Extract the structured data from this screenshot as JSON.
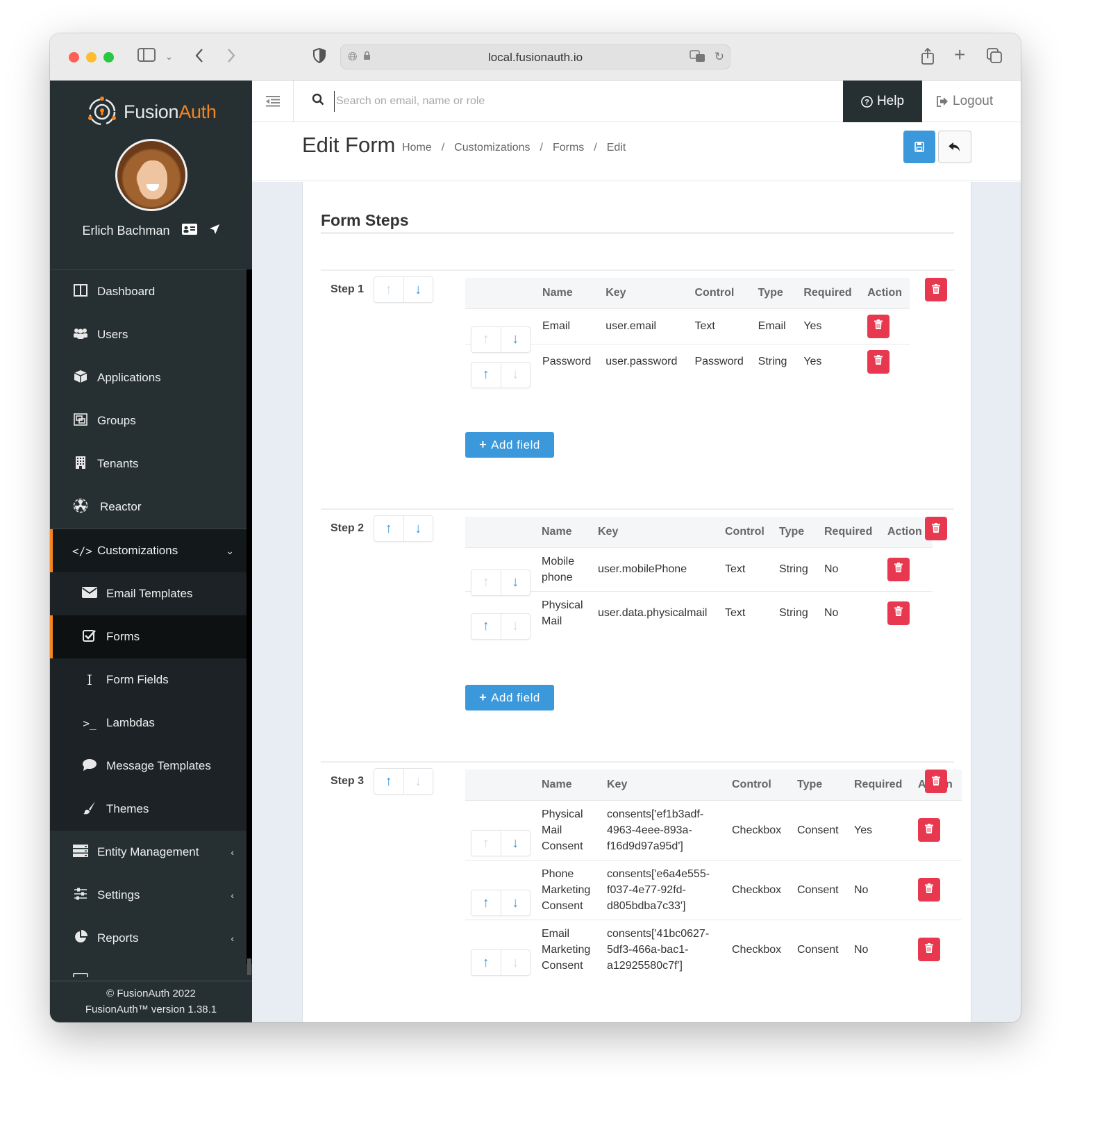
{
  "browser": {
    "url": "local.fusionauth.io"
  },
  "brand": {
    "name_part1": "Fusion",
    "name_part2": "Auth",
    "accent": "#f58320"
  },
  "user": {
    "name": "Erlich Bachman"
  },
  "sidebar": {
    "items": [
      {
        "label": "Dashboard",
        "icon": "dashboard-icon"
      },
      {
        "label": "Users",
        "icon": "users-icon"
      },
      {
        "label": "Applications",
        "icon": "cube-icon"
      },
      {
        "label": "Groups",
        "icon": "groups-icon"
      },
      {
        "label": "Tenants",
        "icon": "building-icon"
      },
      {
        "label": "Reactor",
        "icon": "radiation-icon"
      }
    ],
    "customizations": {
      "label": "Customizations",
      "children": [
        {
          "label": "Email Templates",
          "icon": "envelope-icon"
        },
        {
          "label": "Forms",
          "icon": "checkbox-icon",
          "active": true
        },
        {
          "label": "Form Fields",
          "icon": "text-cursor-icon"
        },
        {
          "label": "Lambdas",
          "icon": "terminal-icon"
        },
        {
          "label": "Message Templates",
          "icon": "comment-icon"
        },
        {
          "label": "Themes",
          "icon": "paintbrush-icon"
        }
      ]
    },
    "collapsed": [
      {
        "label": "Entity Management",
        "icon": "server-icon"
      },
      {
        "label": "Settings",
        "icon": "sliders-icon"
      },
      {
        "label": "Reports",
        "icon": "pie-chart-icon"
      }
    ],
    "footer": {
      "copyright": "© FusionAuth 2022",
      "version": "FusionAuth™ version 1.38.1"
    }
  },
  "topbar": {
    "search_placeholder": "Search on email, name or role",
    "help_label": "Help",
    "logout_label": "Logout"
  },
  "page": {
    "title": "Edit Form",
    "breadcrumb": [
      "Home",
      "Customizations",
      "Forms",
      "Edit"
    ]
  },
  "form": {
    "section_title": "Form Steps",
    "columns": [
      "Name",
      "Key",
      "Control",
      "Type",
      "Required",
      "Action"
    ],
    "add_field_label": "Add field",
    "steps": [
      {
        "label": "Step 1",
        "can_move_up": false,
        "can_move_down": true,
        "fields": [
          {
            "name": "Email",
            "key": "user.email",
            "control": "Text",
            "type": "Email",
            "required": "Yes",
            "can_move_up": false,
            "can_move_down": true
          },
          {
            "name": "Password",
            "key": "user.password",
            "control": "Password",
            "type": "String",
            "required": "Yes",
            "can_move_up": true,
            "can_move_down": false
          }
        ]
      },
      {
        "label": "Step 2",
        "can_move_up": true,
        "can_move_down": true,
        "fields": [
          {
            "name": "Mobile phone",
            "key": "user.mobilePhone",
            "control": "Text",
            "type": "String",
            "required": "No",
            "can_move_up": false,
            "can_move_down": true
          },
          {
            "name": "Physical Mail",
            "key": "user.data.physicalmail",
            "control": "Text",
            "type": "String",
            "required": "No",
            "can_move_up": true,
            "can_move_down": false
          }
        ]
      },
      {
        "label": "Step 3",
        "can_move_up": true,
        "can_move_down": false,
        "fields": [
          {
            "name": "Physical Mail Consent",
            "key": "consents['ef1b3adf-4963-4eee-893a-f16d9d97a95d']",
            "control": "Checkbox",
            "type": "Consent",
            "required": "Yes",
            "can_move_up": false,
            "can_move_down": true
          },
          {
            "name": "Phone Marketing Consent",
            "key": "consents['e6a4e555-f037-4e77-92fd-d805bdba7c33']",
            "control": "Checkbox",
            "type": "Consent",
            "required": "No",
            "can_move_up": true,
            "can_move_down": true
          },
          {
            "name": "Email Marketing Consent",
            "key": "consents['41bc0627-5df3-466a-bac1-a12925580c7f']",
            "control": "Checkbox",
            "type": "Consent",
            "required": "No",
            "can_move_up": true,
            "can_move_down": false
          }
        ]
      }
    ]
  },
  "colors": {
    "primary": "#3a98db",
    "danger": "#e8384f",
    "sidebar_bg": "#263033"
  }
}
